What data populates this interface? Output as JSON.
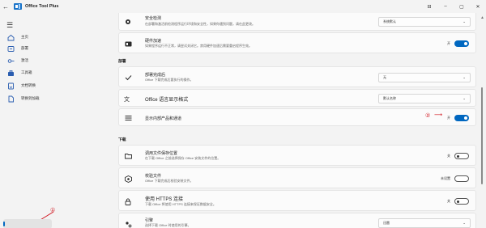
{
  "window": {
    "title": "Office Tool Plus",
    "subtitle": "",
    "controls": [
      "⊟",
      "–",
      "▢",
      "✕"
    ]
  },
  "sidebar": {
    "items": [
      {
        "label": "主页",
        "icon": "home-icon"
      },
      {
        "label": "部署",
        "icon": "deploy-icon"
      },
      {
        "label": "激活",
        "icon": "key-icon"
      },
      {
        "label": "工具箱",
        "icon": "toolbox-icon"
      },
      {
        "label": "文档转换",
        "icon": "convert-icon"
      },
      {
        "label": "转换到加载",
        "icon": "document-icon"
      }
    ]
  },
  "top_cards": [
    {
      "title": "安全检测",
      "desc": "在部署和激活前检测程序运行环境和安全性，如果你遇到问题，请在此更改。",
      "control": "dropdown",
      "value": "系统默认"
    },
    {
      "title": "硬件加速",
      "desc": "如果程序运行不正常，请尝试关闭它。禁用硬件加速后需要重启程序生效。",
      "control": "toggle",
      "state": "开"
    }
  ],
  "section_deploy": {
    "label": "部署",
    "cards": [
      {
        "title": "部署完成后",
        "desc": "Office 下载完成后要执行的操作。",
        "control": "dropdown",
        "value": "无"
      },
      {
        "title": "Office 语言显示格式",
        "desc": "",
        "control": "dropdown",
        "value": "默认名称"
      },
      {
        "title": "显示内部产品和通道",
        "desc": "",
        "control": "toggle",
        "state": "开"
      }
    ]
  },
  "section_download": {
    "label": "下载",
    "cards": [
      {
        "title": "调用文件保存位置",
        "desc": "在下载 Office 之前选择保存 Office 安装文件的位置。",
        "control": "toggle",
        "state": "关"
      },
      {
        "title": "校验文件",
        "desc": "Office 下载完成后校验安装文件。",
        "control": "toggle",
        "state": "未设置"
      },
      {
        "title": "使用 HTTPS 连接",
        "desc": "下载 Office 将使用 HTTPS 连接来保证数据安全。",
        "control": "toggle",
        "state": "关"
      },
      {
        "title": "引擎",
        "desc": "选择下载 Office 时使用的引擎。",
        "control": "dropdown",
        "value": "迅雷"
      }
    ]
  },
  "annotations": {
    "marker1": "①",
    "marker2": "②",
    "arrow": "⟶"
  },
  "colors": {
    "accent": "#0067c0",
    "annotation": "#d0141e"
  }
}
